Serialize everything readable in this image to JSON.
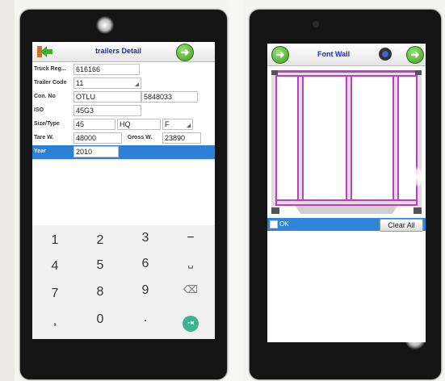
{
  "left_screen": {
    "title": "trailers Detail",
    "fields": {
      "truck_reg": {
        "label": "Truck Reg...",
        "value": "616166"
      },
      "trailer_code": {
        "label": "Trailer Code",
        "value": "11"
      },
      "con_no": {
        "label": "Con. No",
        "value": "OTLU",
        "value2": "5848033"
      },
      "iso": {
        "label": "ISO",
        "value": "45G3"
      },
      "size_type": {
        "label": "Size/Type",
        "size": "45",
        "type": "HQ",
        "extra": "F"
      },
      "tare": {
        "label": "Tare W.",
        "value": "48000",
        "gross_label": "Gross W.",
        "gross_value": "23890"
      },
      "year": {
        "label": "Year",
        "value": "2010"
      }
    },
    "keypad": {
      "row1": [
        "1",
        "2",
        "3",
        "−"
      ],
      "row2": [
        "4",
        "5",
        "6",
        "␣"
      ],
      "row3": [
        "7",
        "8",
        "9",
        "⌫"
      ],
      "row4": [
        ",",
        "0",
        ".",
        "⇥"
      ]
    }
  },
  "right_screen": {
    "title": "Font Wall",
    "ok_label": "OK",
    "clear_label": "Clear All"
  },
  "icons": {
    "back": "arrow-left-icon",
    "forward": "arrow-right-icon",
    "camera": "camera-icon"
  },
  "colors": {
    "accent_green": "#3c9d1f",
    "selection_blue": "#2e7fd6",
    "title_blue": "#1a2db7",
    "wall_magenta": "#c03cc0",
    "enter_green": "#3fb38f"
  }
}
